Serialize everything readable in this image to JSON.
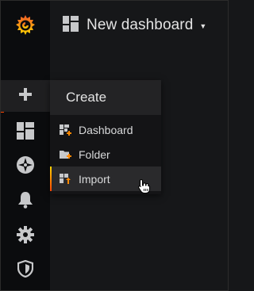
{
  "topbar": {
    "dashboard_title": "New dashboard"
  },
  "create_menu": {
    "header": "Create",
    "items": [
      {
        "label": "Dashboard",
        "icon": "dashboard-add-icon"
      },
      {
        "label": "Folder",
        "icon": "folder-add-icon"
      },
      {
        "label": "Import",
        "icon": "import-icon"
      }
    ]
  },
  "sidebar": {
    "icons": [
      "grafana-logo",
      "plus-icon",
      "dashboards-icon",
      "compass-icon",
      "bell-icon",
      "gear-icon",
      "shield-icon"
    ]
  },
  "colors": {
    "accent_start": "#ffd500",
    "accent_end": "#ff4400",
    "background": "#161719",
    "sidebar": "#0b0c0e"
  }
}
